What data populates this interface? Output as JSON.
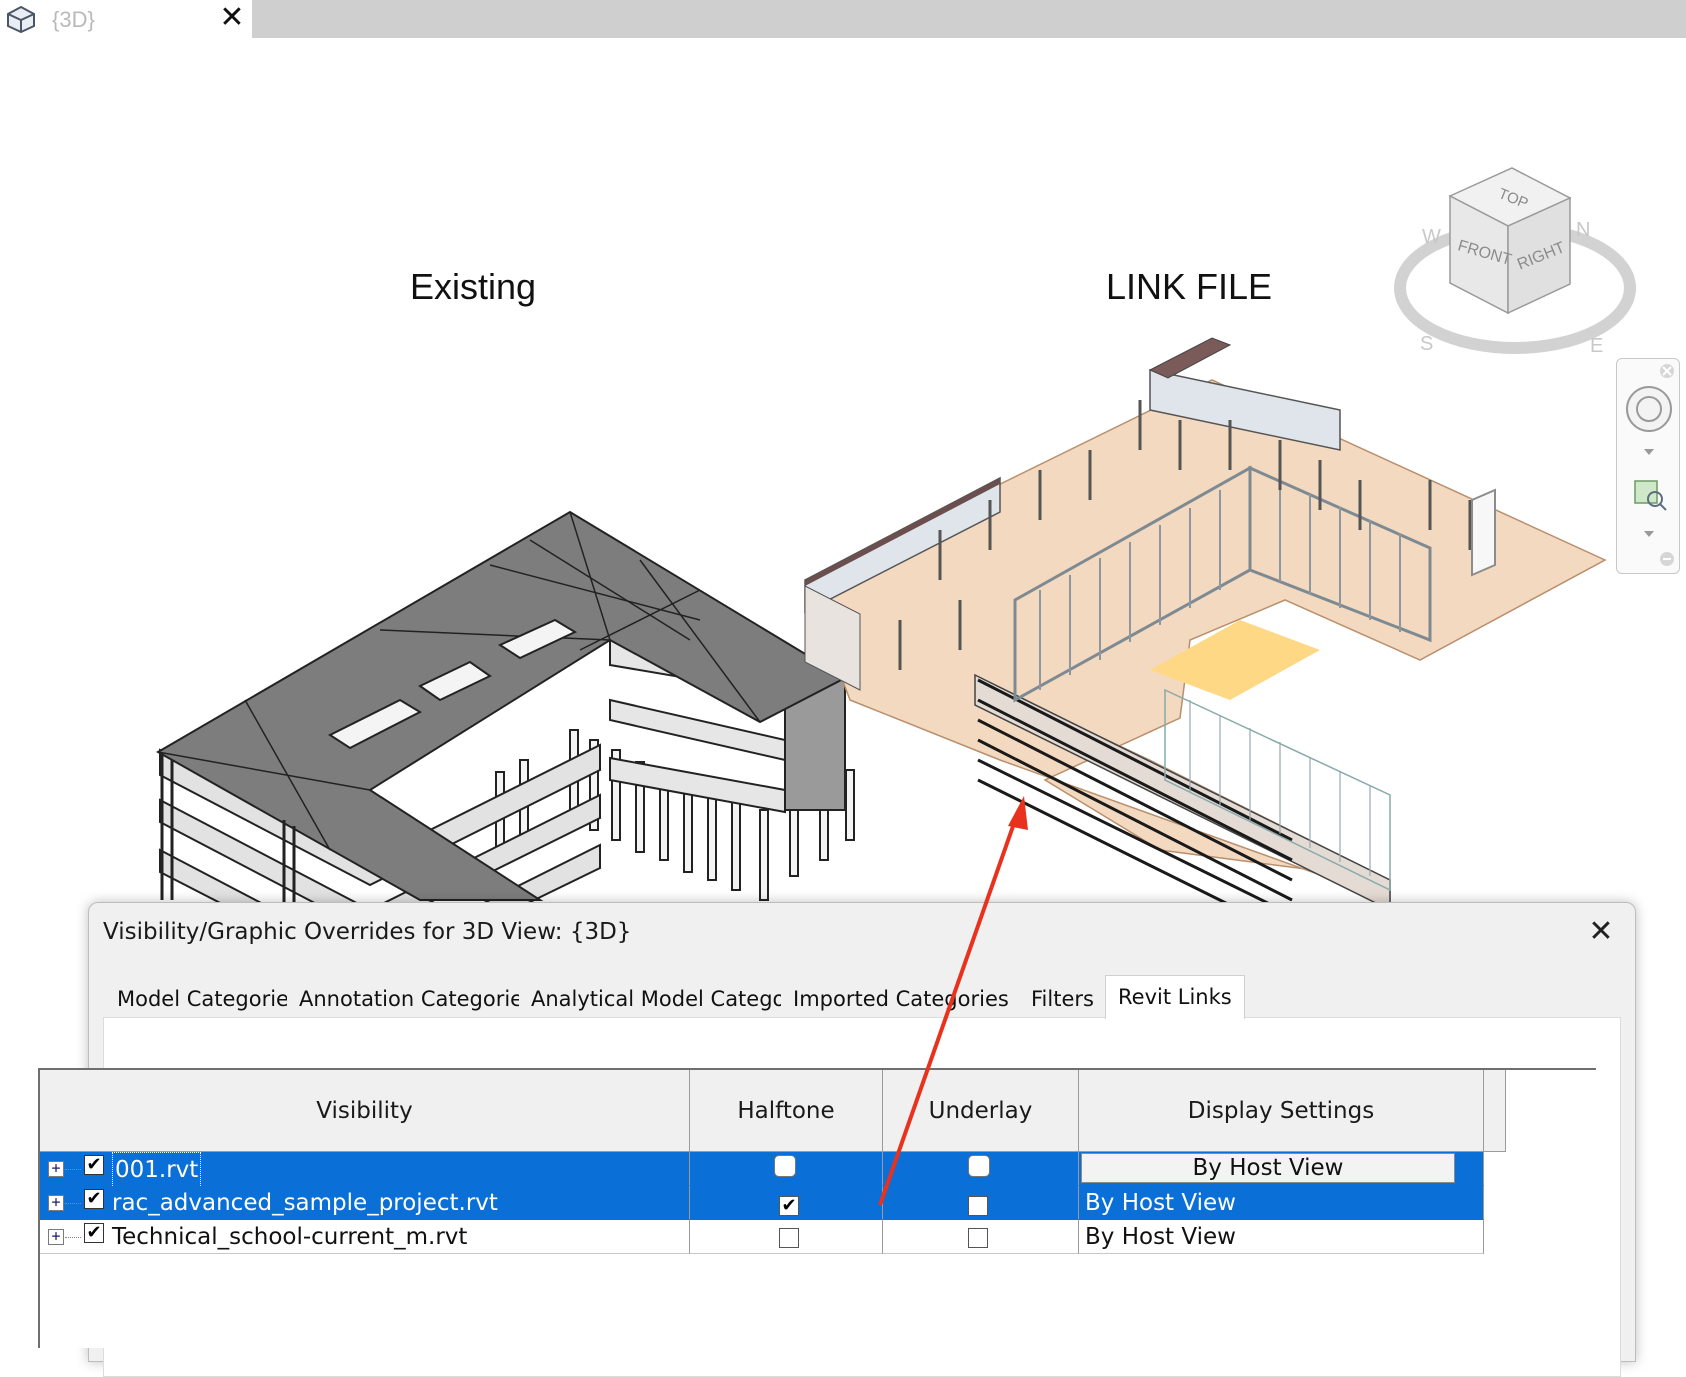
{
  "view_tab": {
    "label": "{3D}",
    "close_glyph": "✕",
    "icon": "3d-house-icon"
  },
  "viewport": {
    "caption_left": "Existing",
    "caption_right": "LINK FILE",
    "viewcube": {
      "top": "TOP",
      "front": "FRONT",
      "right": "RIGHT",
      "compass": [
        "W",
        "N",
        "S",
        "E"
      ]
    }
  },
  "dialog": {
    "title": "Visibility/Graphic Overrides for 3D View: {3D}",
    "close_glyph": "✕",
    "tabs": [
      {
        "label": "Model Categories",
        "active": false
      },
      {
        "label": "Annotation Categories",
        "active": false
      },
      {
        "label": "Analytical Model Categories",
        "active": false
      },
      {
        "label": "Imported Categories",
        "active": false
      },
      {
        "label": "Filters",
        "active": false
      },
      {
        "label": "Revit Links",
        "active": true
      }
    ],
    "table": {
      "columns": [
        "Visibility",
        "Halftone",
        "Underlay",
        "Display Settings"
      ],
      "rows": [
        {
          "name": "001.rvt",
          "visible": true,
          "halftone": false,
          "underlay": false,
          "display": "By Host View",
          "selected": true
        },
        {
          "name": "rac_advanced_sample_project.rvt",
          "visible": true,
          "halftone": true,
          "underlay": false,
          "display": "By Host View",
          "selected": true
        },
        {
          "name": "Technical_school-current_m.rvt",
          "visible": true,
          "halftone": false,
          "underlay": false,
          "display": "By Host View",
          "selected": false
        }
      ]
    }
  },
  "colors": {
    "selection": "#0a6fd6",
    "annotation_arrow": "#e8321e",
    "slab": "#f3d9c0",
    "roof": "#7d7d7d"
  }
}
